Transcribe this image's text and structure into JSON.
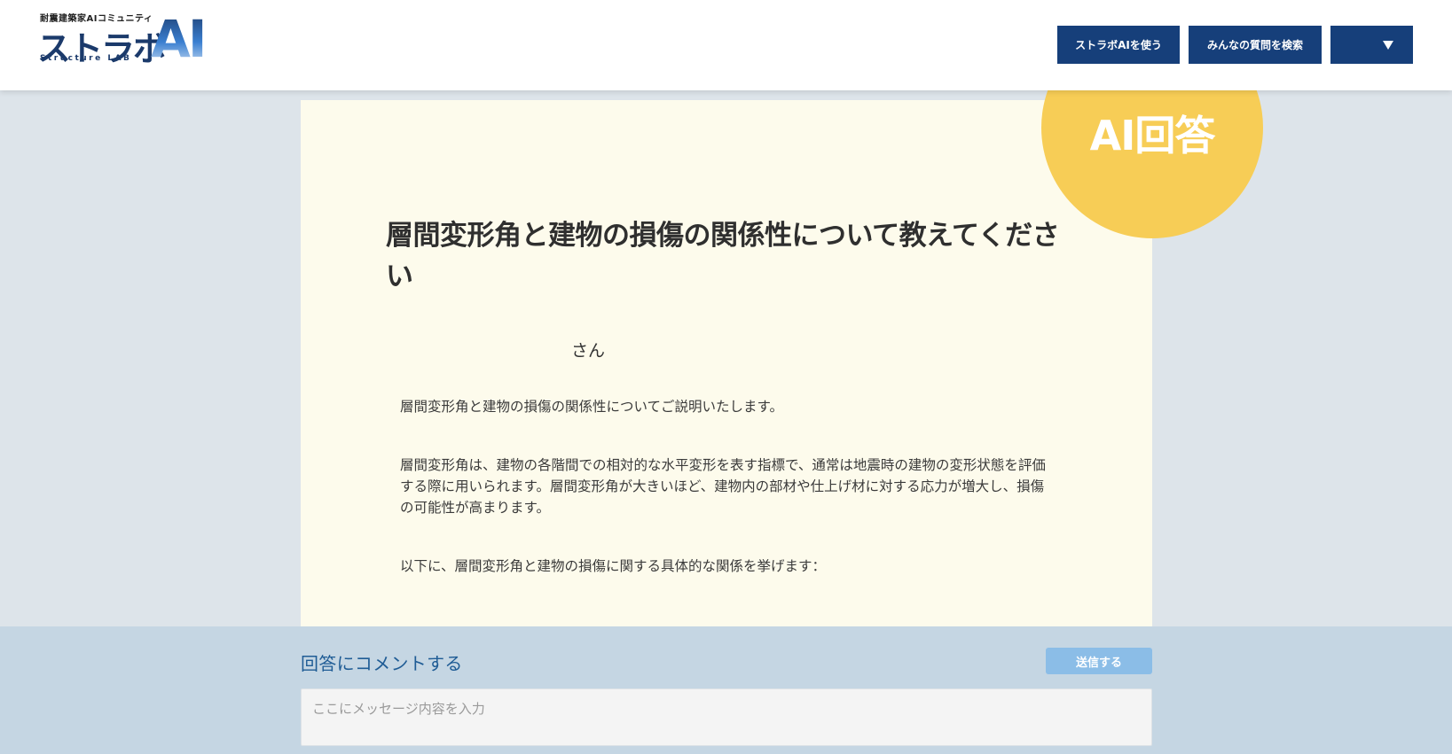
{
  "header": {
    "logo_subtitle": "耐震建築家AIコミュニティ",
    "logo_main": "ストラボ",
    "logo_ai": "AI",
    "logo_english": "Structure LAB",
    "nav": [
      {
        "label": "ストラボAIを使う"
      },
      {
        "label": "みんなの質問を検索"
      },
      {
        "label": ""
      }
    ]
  },
  "answer": {
    "badge": "AI回答",
    "title": "層間変形角と建物の損傷の関係性について教えてください",
    "author_suffix": "さん",
    "paragraphs": [
      "層間変形角と建物の損傷の関係性についてご説明いたします。",
      "層間変形角は、建物の各階間での相対的な水平変形を表す指標で、通常は地震時の建物の変形状態を評価する際に用いられます。層間変形角が大きいほど、建物内の部材や仕上げ材に対する応力が増大し、損傷の可能性が高まります。",
      "以下に、層間変形角と建物の損傷に関する具体的な関係を挙げます："
    ]
  },
  "comment": {
    "label": "回答にコメントする",
    "send_label": "送信する",
    "placeholder": "ここにメッセージ内容を入力"
  },
  "colors": {
    "nav_bg": "#163f7a",
    "card_bg": "#fdfbec",
    "badge": "#f7cd56",
    "comment_bg": "#c5d6e3",
    "send_btn": "#8bbde7",
    "page_bg": "#dde4ea"
  }
}
